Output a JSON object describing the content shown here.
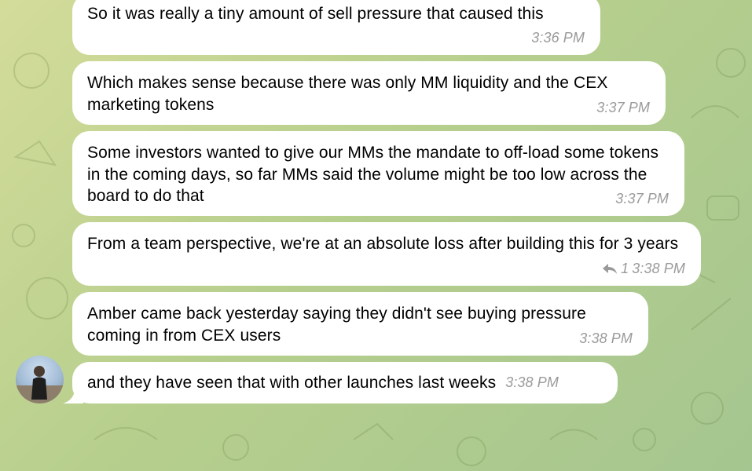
{
  "messages": [
    {
      "text": "So it was really a tiny amount of sell pressure that caused this",
      "time": "3:36 PM"
    },
    {
      "text": "Which makes sense because there was only MM liquidity and the CEX marketing tokens",
      "time": "3:37 PM"
    },
    {
      "text": "Some investors wanted to give our MMs the mandate to off-load some tokens in the coming days, so far MMs said the volume might be too low across the board to do that",
      "time": "3:37 PM"
    },
    {
      "text": "From a team perspective, we're at an absolute loss after building this for 3 years",
      "time": "3:38 PM",
      "reply_count": "1"
    },
    {
      "text": "Amber came back yesterday saying they didn't see buying pressure coming in from CEX users",
      "time": "3:38 PM"
    },
    {
      "text": "and they have seen that with other launches last weeks",
      "time": "3:38 PM"
    }
  ],
  "colors": {
    "bubble": "#ffffff",
    "timestamp": "#9a9a9a",
    "background": "#b7cf8d"
  },
  "icons": {
    "reply": "reply-arrow-icon",
    "avatar": "user-avatar"
  }
}
